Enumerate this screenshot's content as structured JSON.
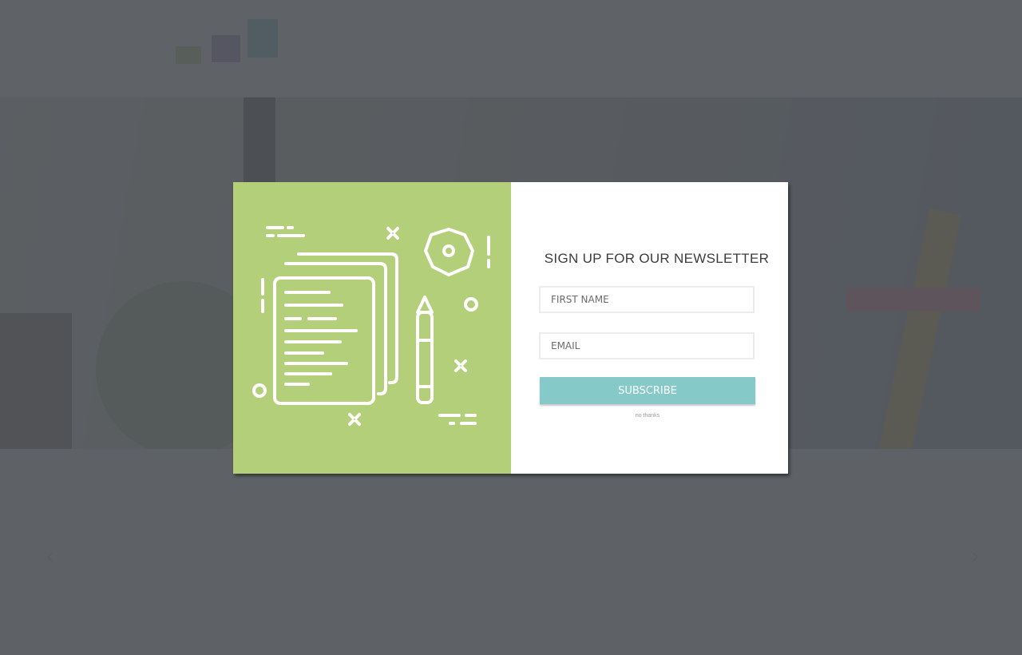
{
  "background_page": {
    "logo_text": "",
    "nav": [
      "",
      "",
      "",
      ""
    ],
    "hero_title": "",
    "hero_subtitle": "",
    "intro_text": ""
  },
  "modal": {
    "title": "SIGN UP FOR OUR NEWSLETTER",
    "first_name_placeholder": "FIRST NAME",
    "email_placeholder": "EMAIL",
    "subscribe_label": "SUBSCRIBE",
    "no_thanks_label": "no thanks"
  },
  "colors": {
    "art_panel": "#b3cf7a",
    "subscribe_button": "#85c9c9",
    "overlay": "rgba(78, 82, 88, 0.90)"
  },
  "icons": {
    "illustration": "documents-pencil-illustration",
    "prev": "chevron-left-icon",
    "next": "chevron-right-icon"
  }
}
